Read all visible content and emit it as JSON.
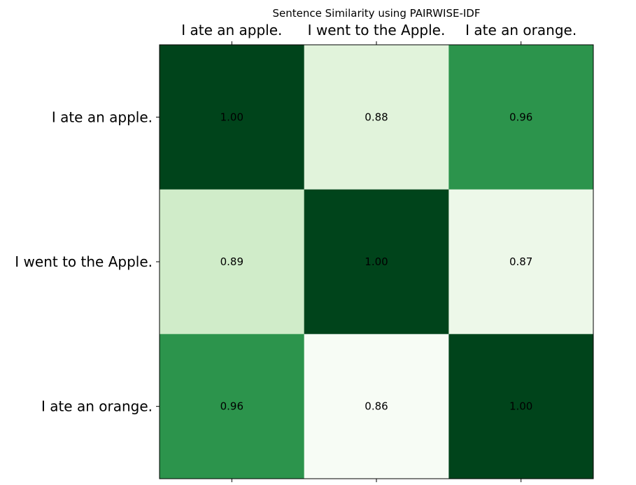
{
  "chart_data": {
    "type": "heatmap",
    "title": "Sentence Similarity using PAIRWISE-IDF",
    "x_labels": [
      "I ate an apple.",
      "I went to the Apple.",
      "I ate an orange."
    ],
    "y_labels": [
      "I ate an apple.",
      "I went to the Apple.",
      "I ate an orange."
    ],
    "values": [
      [
        1.0,
        0.88,
        0.96
      ],
      [
        0.89,
        1.0,
        0.87
      ],
      [
        0.96,
        0.86,
        1.0
      ]
    ],
    "value_labels": [
      [
        "1.00",
        "0.88",
        "0.96"
      ],
      [
        "0.89",
        "1.00",
        "0.87"
      ],
      [
        "0.96",
        "0.86",
        "1.00"
      ]
    ],
    "colormap": "Greens",
    "vmin": 0.86,
    "vmax": 1.0,
    "x_tick_position": "top",
    "grid": false
  }
}
